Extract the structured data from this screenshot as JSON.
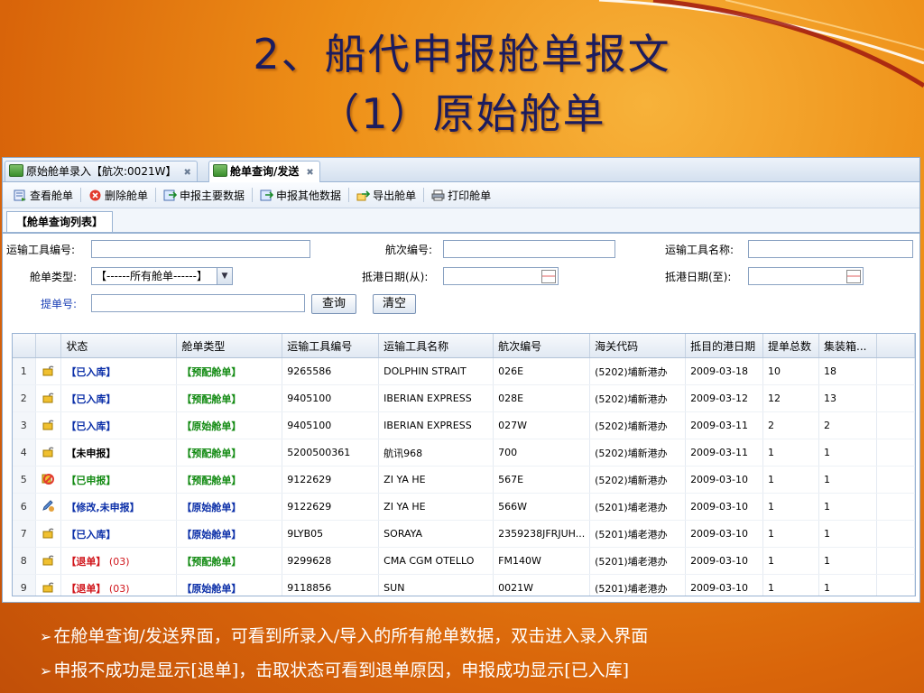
{
  "slide": {
    "title_line1": "2、船代申报舱单报文",
    "title_line2": "（1）原始舱单",
    "bullet_marker": "➢",
    "bullets": [
      "在舱单查询/发送界面，可看到所录入/导入的所有舱单数据，双击进入录入界面",
      "申报不成功是显示[退单]，击取状态可看到退单原因，申报成功显示[已入库]"
    ]
  },
  "tabs": [
    {
      "label": "原始舱单录入【航次:0021W】",
      "close": "✖"
    },
    {
      "label": "舱单查询/发送",
      "close": "✖"
    }
  ],
  "toolbar": {
    "view": "查看舱单",
    "delete": "删除舱单",
    "declare_main": "申报主要数据",
    "declare_other": "申报其他数据",
    "export": "导出舱单",
    "print": "打印舱单"
  },
  "subtab": "【舱单查询列表】",
  "form": {
    "transport_no_label": "运输工具编号:",
    "voyage_no_label": "航次编号:",
    "transport_name_label": "运输工具名称:",
    "manifest_type_label": "舱单类型:",
    "manifest_type_value": "【------所有舱单------】",
    "arrive_from_label": "抵港日期(从):",
    "arrive_to_label": "抵港日期(至):",
    "bill_no_label": "提单号:",
    "query_button": "查询",
    "clear_button": "清空"
  },
  "grid": {
    "columns": [
      "状态",
      "舱单类型",
      "运输工具编号",
      "运输工具名称",
      "航次编号",
      "海关代码",
      "抵目的港日期",
      "提单总数",
      "集装箱..."
    ],
    "rows": [
      {
        "no": "1",
        "icon": "lock",
        "status": "【已入库】",
        "status_color": "blue",
        "status_extra": "",
        "type": "【预配舱单】",
        "type_color": "green",
        "transport_no": "9265586",
        "transport_name": "DOLPHIN STRAIT",
        "voyage": "026E",
        "customs": "(5202)埔新港办",
        "date": "2009-03-18",
        "bills": "10",
        "containers": "18"
      },
      {
        "no": "2",
        "icon": "lock",
        "status": "【已入库】",
        "status_color": "blue",
        "status_extra": "",
        "type": "【预配舱单】",
        "type_color": "green",
        "transport_no": "9405100",
        "transport_name": "IBERIAN EXPRESS",
        "voyage": "028E",
        "customs": "(5202)埔新港办",
        "date": "2009-03-12",
        "bills": "12",
        "containers": "13"
      },
      {
        "no": "3",
        "icon": "lock",
        "status": "【已入库】",
        "status_color": "blue",
        "status_extra": "",
        "type": "【原始舱单】",
        "type_color": "green",
        "transport_no": "9405100",
        "transport_name": "IBERIAN EXPRESS",
        "voyage": "027W",
        "customs": "(5202)埔新港办",
        "date": "2009-03-11",
        "bills": "2",
        "containers": "2"
      },
      {
        "no": "4",
        "icon": "lock",
        "status": "【未申报】",
        "status_color": "black",
        "status_extra": "",
        "type": "【预配舱单】",
        "type_color": "green",
        "transport_no": "5200500361",
        "transport_name": "航讯968",
        "voyage": "700",
        "customs": "(5202)埔新港办",
        "date": "2009-03-11",
        "bills": "1",
        "containers": "1"
      },
      {
        "no": "5",
        "icon": "forbidden",
        "status": "【已申报】",
        "status_color": "green",
        "status_extra": "",
        "type": "【预配舱单】",
        "type_color": "green",
        "transport_no": "9122629",
        "transport_name": "ZI YA HE",
        "voyage": "567E",
        "customs": "(5202)埔新港办",
        "date": "2009-03-10",
        "bills": "1",
        "containers": "1"
      },
      {
        "no": "6",
        "icon": "edit",
        "status": "【修改,未申报】",
        "status_color": "blue",
        "status_extra": "",
        "type": "【原始舱单】",
        "type_color": "blue",
        "transport_no": "9122629",
        "transport_name": "ZI YA HE",
        "voyage": "566W",
        "customs": "(5201)埔老港办",
        "date": "2009-03-10",
        "bills": "1",
        "containers": "1"
      },
      {
        "no": "7",
        "icon": "lock",
        "status": "【已入库】",
        "status_color": "blue",
        "status_extra": "",
        "type": "【原始舱单】",
        "type_color": "blue",
        "transport_no": "9LYB05",
        "transport_name": "SORAYA",
        "voyage": "2359238JFRJUH...",
        "customs": "(5201)埔老港办",
        "date": "2009-03-10",
        "bills": "1",
        "containers": "1"
      },
      {
        "no": "8",
        "icon": "lock",
        "status": "【退单】",
        "status_color": "red",
        "status_extra": "(03)",
        "type": "【预配舱单】",
        "type_color": "green",
        "transport_no": "9299628",
        "transport_name": "CMA CGM OTELLO",
        "voyage": "FM140W",
        "customs": "(5201)埔老港办",
        "date": "2009-03-10",
        "bills": "1",
        "containers": "1"
      },
      {
        "no": "9",
        "icon": "lock",
        "status": "【退单】",
        "status_color": "red",
        "status_extra": "(03)",
        "type": "【原始舱单】",
        "type_color": "blue",
        "transport_no": "9118856",
        "transport_name": "SUN",
        "voyage": "0021W",
        "customs": "(5201)埔老港办",
        "date": "2009-03-10",
        "bills": "1",
        "containers": "1"
      }
    ]
  }
}
